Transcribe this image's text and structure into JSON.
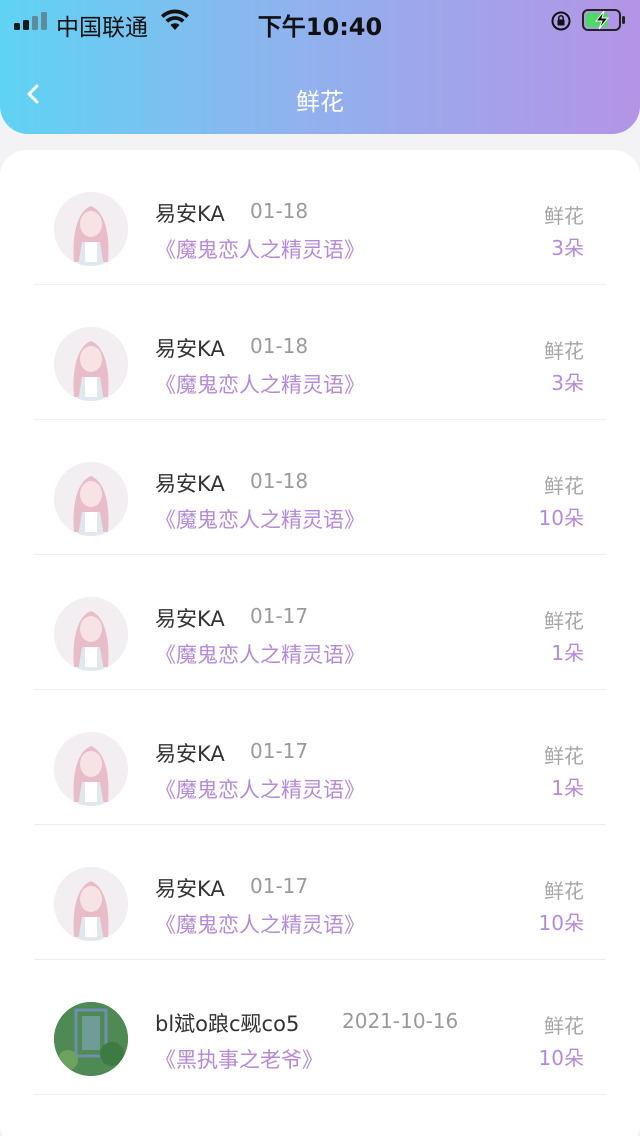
{
  "status_bar": {
    "carrier": "中国联通",
    "time": "下午10:40",
    "signal_icon": "signal-bars-icon",
    "wifi_icon": "wifi-icon",
    "orientation_icon": "orientation-lock-icon",
    "battery_icon": "battery-charging-icon"
  },
  "nav": {
    "title": "鲜花",
    "back_icon": "chevron-left-icon"
  },
  "colors": {
    "accent": "#b58ad9",
    "header_gradient_start": "#5fd3f3",
    "header_gradient_end": "#b494e6"
  },
  "records": [
    {
      "user": "易安KA",
      "date": "01-18",
      "book": "《魔鬼恋人之精灵语》",
      "gift_label": "鲜花",
      "count": "3朵"
    },
    {
      "user": "易安KA",
      "date": "01-18",
      "book": "《魔鬼恋人之精灵语》",
      "gift_label": "鲜花",
      "count": "3朵"
    },
    {
      "user": "易安KA",
      "date": "01-18",
      "book": "《魔鬼恋人之精灵语》",
      "gift_label": "鲜花",
      "count": "10朵"
    },
    {
      "user": "易安KA",
      "date": "01-17",
      "book": "《魔鬼恋人之精灵语》",
      "gift_label": "鲜花",
      "count": "1朵"
    },
    {
      "user": "易安KA",
      "date": "01-17",
      "book": "《魔鬼恋人之精灵语》",
      "gift_label": "鲜花",
      "count": "1朵"
    },
    {
      "user": "易安KA",
      "date": "01-17",
      "book": "《魔鬼恋人之精灵语》",
      "gift_label": "鲜花",
      "count": "10朵"
    },
    {
      "user": "bl斌o踉c觋co5",
      "date": "2021-10-16",
      "book": "《黑执事之老爷》",
      "gift_label": "鲜花",
      "count": "10朵"
    }
  ]
}
